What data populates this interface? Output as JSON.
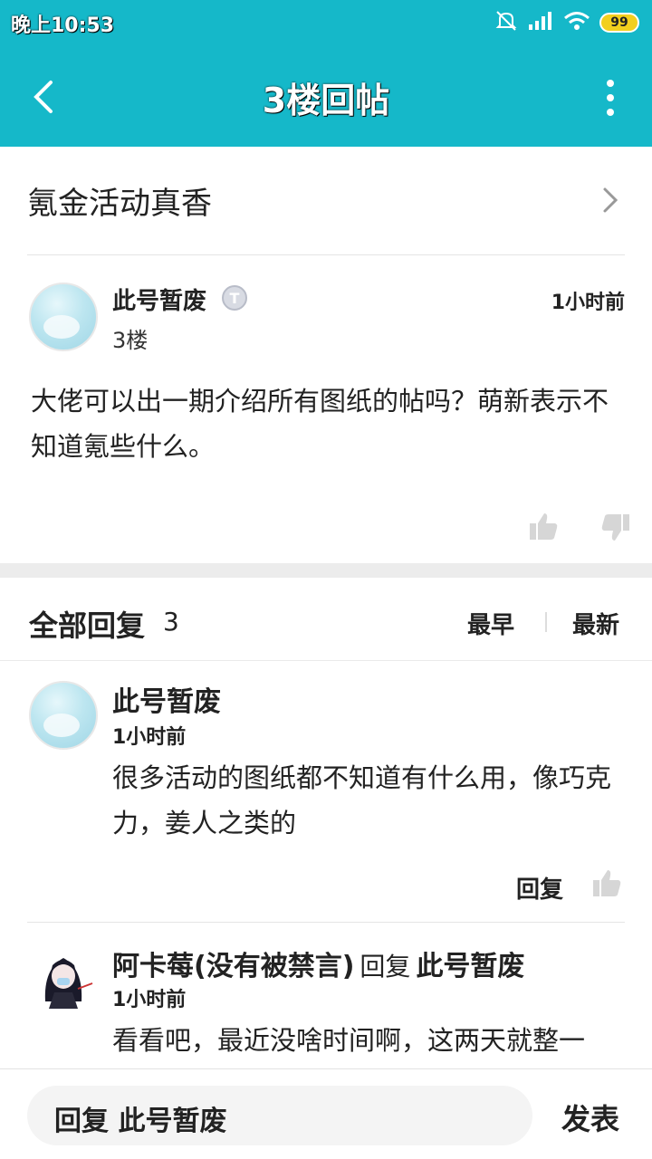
{
  "status_bar": {
    "time": "晚上10:53",
    "battery": "99"
  },
  "header": {
    "title": "3楼回帖"
  },
  "thread": {
    "title": "氪金活动真香"
  },
  "post": {
    "username": "此号暂废",
    "floor": "3楼",
    "time": "1小时前",
    "content": "大佬可以出一期介绍所有图纸的帖吗？萌新表示不知道氪些什么。"
  },
  "replies_header": {
    "label": "全部回复",
    "count": "3",
    "sort_earliest": "最早",
    "sort_newest": "最新"
  },
  "replies": [
    {
      "username": "此号暂废",
      "time": "1小时前",
      "content": "很多活动的图纸都不知道有什么用，像巧克力，姜人之类的",
      "reply_label": "回复"
    },
    {
      "username": "阿卡莓(没有被禁言)",
      "reply_word": "回复",
      "reply_to": "此号暂废",
      "time": "1小时前",
      "content": "看看吧，最近没啥时间啊，这两天就整一"
    }
  ],
  "composer": {
    "placeholder": "回复 此号暂废",
    "send_label": "发表"
  },
  "colors": {
    "accent": "#15b8c9"
  }
}
